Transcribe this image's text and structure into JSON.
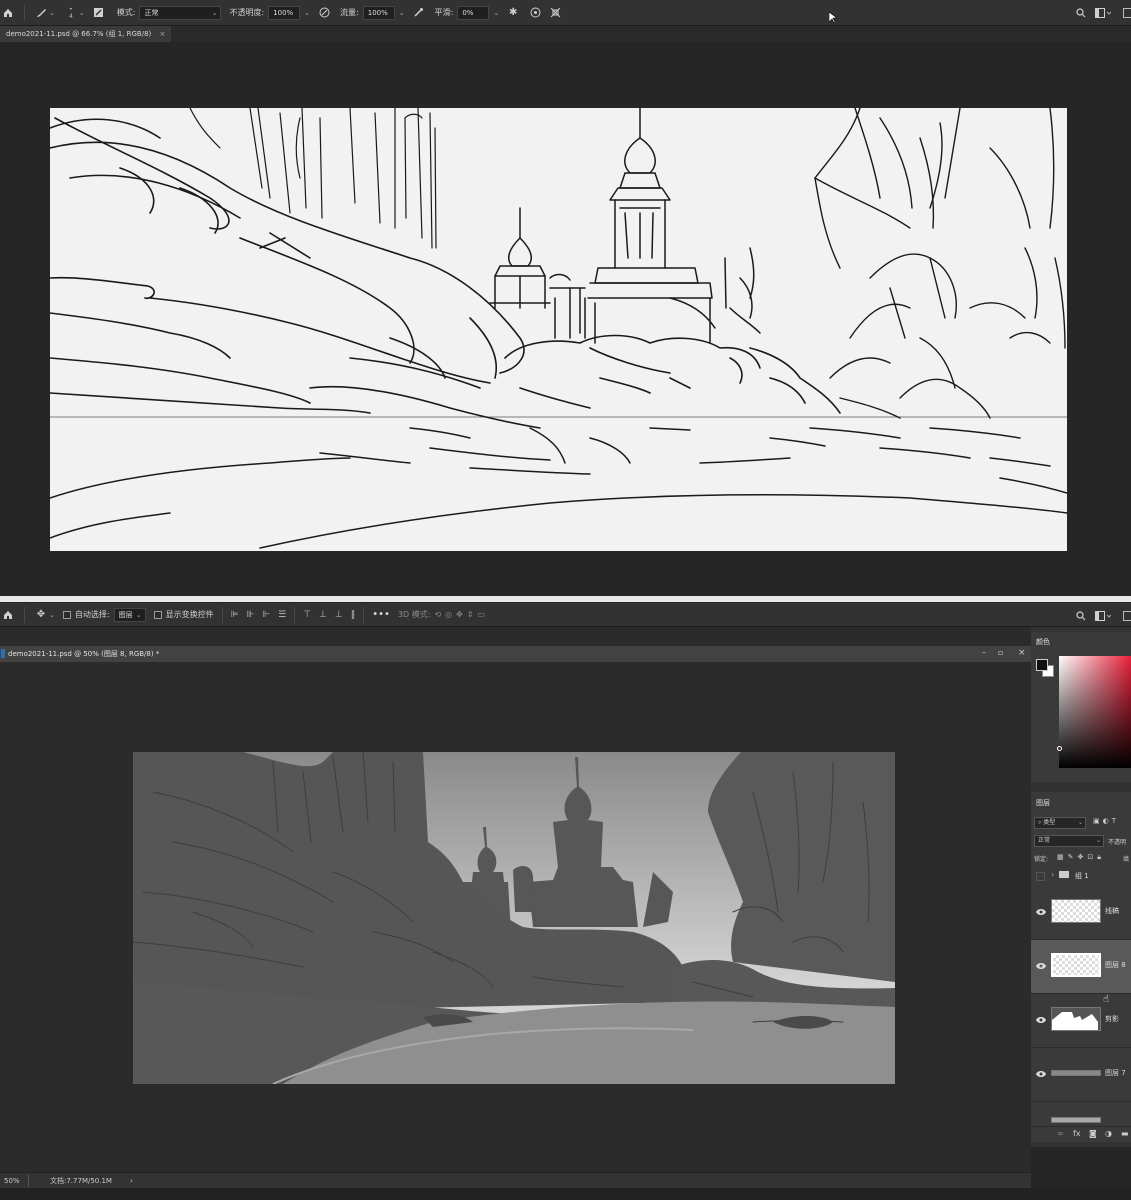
{
  "top": {
    "toolbar": {
      "mode_label": "模式:",
      "mode_value": "正常",
      "opacity_label": "不透明度:",
      "opacity_value": "100%",
      "flow_label": "流量:",
      "flow_value": "100%",
      "smoothing_label": "平滑:",
      "smoothing_value": "0%",
      "brush_size": "4"
    },
    "tab_title": "demo2021-11.psd @ 66.7% (组 1, RGB/8)",
    "tab_close": "×"
  },
  "bottom": {
    "toolbar": {
      "auto_select_label": "自动选择:",
      "auto_select_value": "图层",
      "show_transform_label": "显示变换控件",
      "mode3d_label": "3D 模式:"
    },
    "doc_title": "demo2021-11.psd @ 50% (图层 8, RGB/8) *",
    "window_buttons": [
      "–",
      "▫",
      "×"
    ],
    "color_panel_tab": "颜色",
    "layers_panel": {
      "tab": "图层",
      "kind_filter": "类型",
      "blend_mode": "正常",
      "opacity_label": "不透明",
      "lock_label": "锁定:",
      "fill_label": "填",
      "layers": [
        {
          "name": "组 1",
          "kind": "group",
          "visible": false
        },
        {
          "name": "线稿",
          "kind": "layer",
          "visible": true
        },
        {
          "name": "图层 8",
          "kind": "layer",
          "visible": true,
          "selected": true
        },
        {
          "name": "剪影",
          "kind": "layer",
          "visible": true
        },
        {
          "name": "图层 7",
          "kind": "layer",
          "visible": true
        }
      ]
    },
    "status": {
      "zoom": "50%",
      "doc_size": "文档:7.77M/50.1M",
      "arrow": "›"
    }
  },
  "colors": {
    "ui_dark": "#262626",
    "toolbar": "#323232",
    "canvas_light": "#f2f2f2",
    "silhouette": "#5a5a5a",
    "sky_top": "#888888",
    "sky_bottom": "#d9d9d9",
    "picker_hue": "#e8203a"
  }
}
